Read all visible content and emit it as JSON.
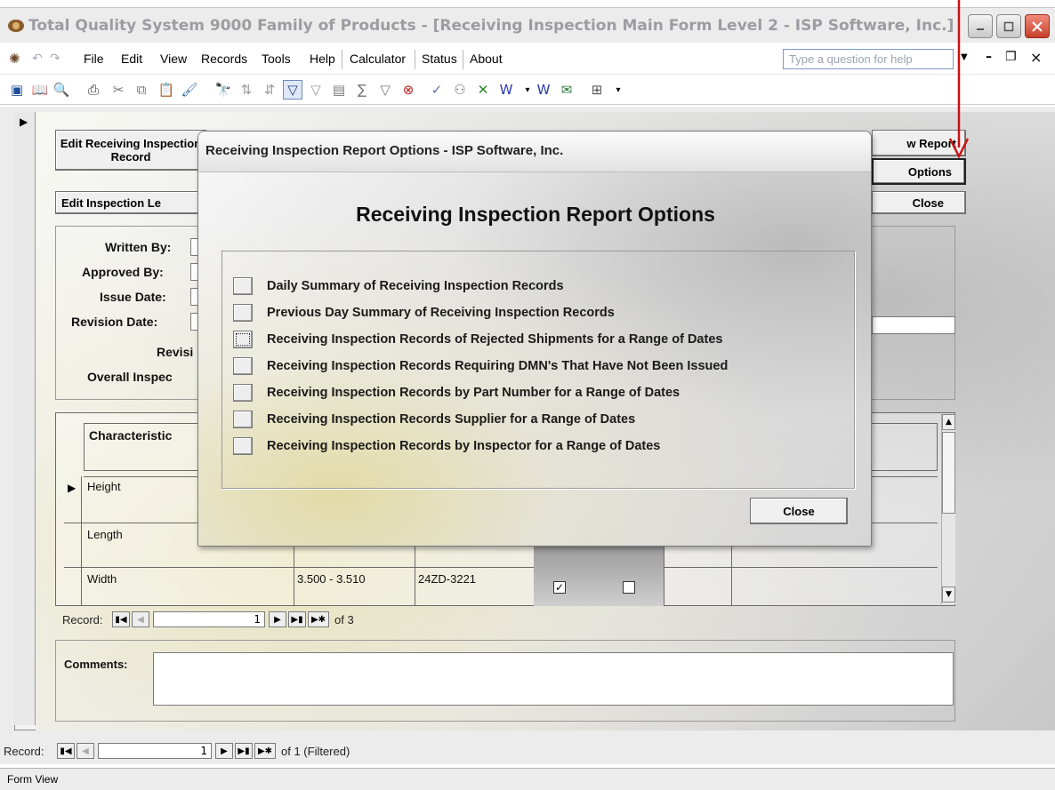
{
  "window": {
    "title": "Total Quality System 9000 Family of Products - [Receiving Inspection Main Form Level 2 - ISP Software, Inc.]"
  },
  "menu": {
    "items": [
      "File",
      "Edit",
      "View",
      "Records",
      "Tools",
      "Help",
      "Calculator",
      "Status",
      "About"
    ],
    "ask_placeholder": "Type a question for help"
  },
  "form": {
    "edit_receiving_button": "Edit Receiving Inspection Record",
    "edit_inspection_level_button": "Edit Inspection Le",
    "view_report_button": "w Report",
    "options_button": "Options",
    "close_button": "Close",
    "fields": {
      "written_by": "Written By:",
      "approved_by": "Approved By:",
      "issue_date": "Issue Date:",
      "revision_date": "Revision Date:",
      "revision": "Revisi",
      "overall_inspection": "Overall Inspec"
    },
    "grid": {
      "header_characteristic": "Characteristic",
      "rows": [
        {
          "characteristic": "Height",
          "spec": "",
          "gage": ""
        },
        {
          "characteristic": "Length",
          "spec": "",
          "gage": ""
        },
        {
          "characteristic": "Width",
          "spec": "3.500 - 3.510",
          "gage": "24ZD-3221"
        }
      ]
    },
    "sub_nav": {
      "label": "Record:",
      "current": "1",
      "of_text": "of 3"
    },
    "comments_label": "Comments:"
  },
  "main_nav": {
    "label": "Record:",
    "current": "1",
    "of_text": "of 1 (Filtered)"
  },
  "status": {
    "text": "Form View"
  },
  "dialog": {
    "title": "Receiving Inspection Report Options - ISP Software, Inc.",
    "heading": "Receiving Inspection Report Options",
    "options": [
      "Daily Summary of Receiving Inspection Records",
      "Previous Day Summary of Receiving Inspection Records",
      "Receiving Inspection Records of Rejected Shipments for a Range of Dates",
      "Receiving Inspection Records Requiring DMN's That Have Not Been Issued",
      "Receiving Inspection Records by Part Number for a Range of Dates",
      "Receiving Inspection Records Supplier for a Range of Dates",
      "Receiving Inspection Records by Inspector for a Range of Dates"
    ],
    "close_button": "Close"
  },
  "colors": {
    "annotation_arrow": "#cc1111"
  }
}
